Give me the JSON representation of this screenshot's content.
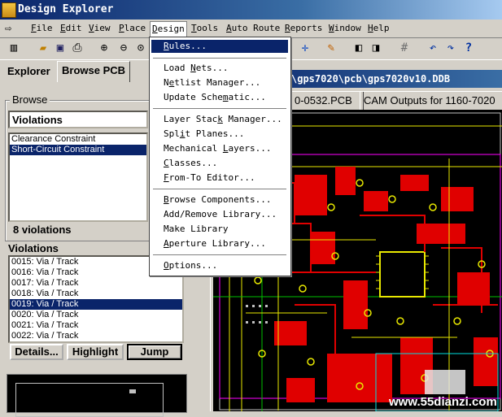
{
  "app": {
    "title": "Design Explorer"
  },
  "menubar": {
    "items": [
      {
        "label": "File",
        "u": "F",
        "rest": "ile"
      },
      {
        "label": "Edit",
        "u": "E",
        "rest": "dit"
      },
      {
        "label": "View",
        "u": "V",
        "rest": "iew"
      },
      {
        "label": "Place",
        "u": "P",
        "rest": "lace"
      },
      {
        "label": "Design",
        "u": "D",
        "rest": "esign"
      },
      {
        "label": "Tools",
        "u": "T",
        "rest": "ools"
      },
      {
        "label": "Auto Route",
        "u": "A",
        "rest": "uto Route"
      },
      {
        "label": "Reports",
        "u": "R",
        "rest": "eports"
      },
      {
        "label": "Window",
        "u": "W",
        "rest": "indow"
      },
      {
        "label": "Help",
        "u": "H",
        "rest": "elp"
      }
    ]
  },
  "design_menu": {
    "items": [
      {
        "pre": "",
        "u": "R",
        "rest": "ules..."
      },
      {
        "pre": "Load ",
        "u": "N",
        "rest": "ets..."
      },
      {
        "pre": "N",
        "u": "e",
        "rest": "tlist Manager..."
      },
      {
        "pre": "Update Sche",
        "u": "m",
        "rest": "atic..."
      },
      {
        "pre": "Layer Stac",
        "u": "k",
        "rest": " Manager..."
      },
      {
        "pre": "Spl",
        "u": "i",
        "rest": "t Planes..."
      },
      {
        "pre": "Mechanical ",
        "u": "L",
        "rest": "ayers..."
      },
      {
        "pre": "",
        "u": "C",
        "rest": "lasses..."
      },
      {
        "pre": "",
        "u": "F",
        "rest": "rom-To Editor..."
      },
      {
        "pre": "",
        "u": "B",
        "rest": "rowse Components..."
      },
      {
        "pre": "Add/Remove Library...",
        "u": "",
        "rest": ""
      },
      {
        "pre": "Make Library",
        "u": "",
        "rest": ""
      },
      {
        "pre": "",
        "u": "A",
        "rest": "perture Library..."
      },
      {
        "pre": "",
        "u": "O",
        "rest": "ptions..."
      }
    ]
  },
  "explorer": {
    "tabs": [
      "Explorer",
      "Browse PCB"
    ],
    "browse_label": "Browse",
    "browse_select": "Violations",
    "rules": [
      "Clearance Constraint",
      "Short-Circuit Constraint"
    ],
    "count_text": "8 violations",
    "violations_label": "Violations",
    "violations": [
      "0015: Via / Track",
      "0016: Via / Track",
      "0017: Via / Track",
      "0018: Via / Track",
      "0019: Via / Track",
      "0020: Via / Track",
      "0021: Via / Track",
      "0022: Via / Track"
    ],
    "buttons": {
      "details": "Details...",
      "highlight": "Highlight",
      "jump": "Jump"
    }
  },
  "document": {
    "path": "\\gps7020\\pcb\\gps7020v10.DDB",
    "tabs": [
      "0-0532.PCB",
      "CAM Outputs for 1160-7020"
    ]
  },
  "watermark": "www.55dianzi.com",
  "colors": {
    "titlebar": "#0a246a",
    "selection": "#0a246a",
    "pcb_bg": "#000000",
    "pcb_red": "#e00000",
    "pcb_yellow": "#e8e800"
  }
}
